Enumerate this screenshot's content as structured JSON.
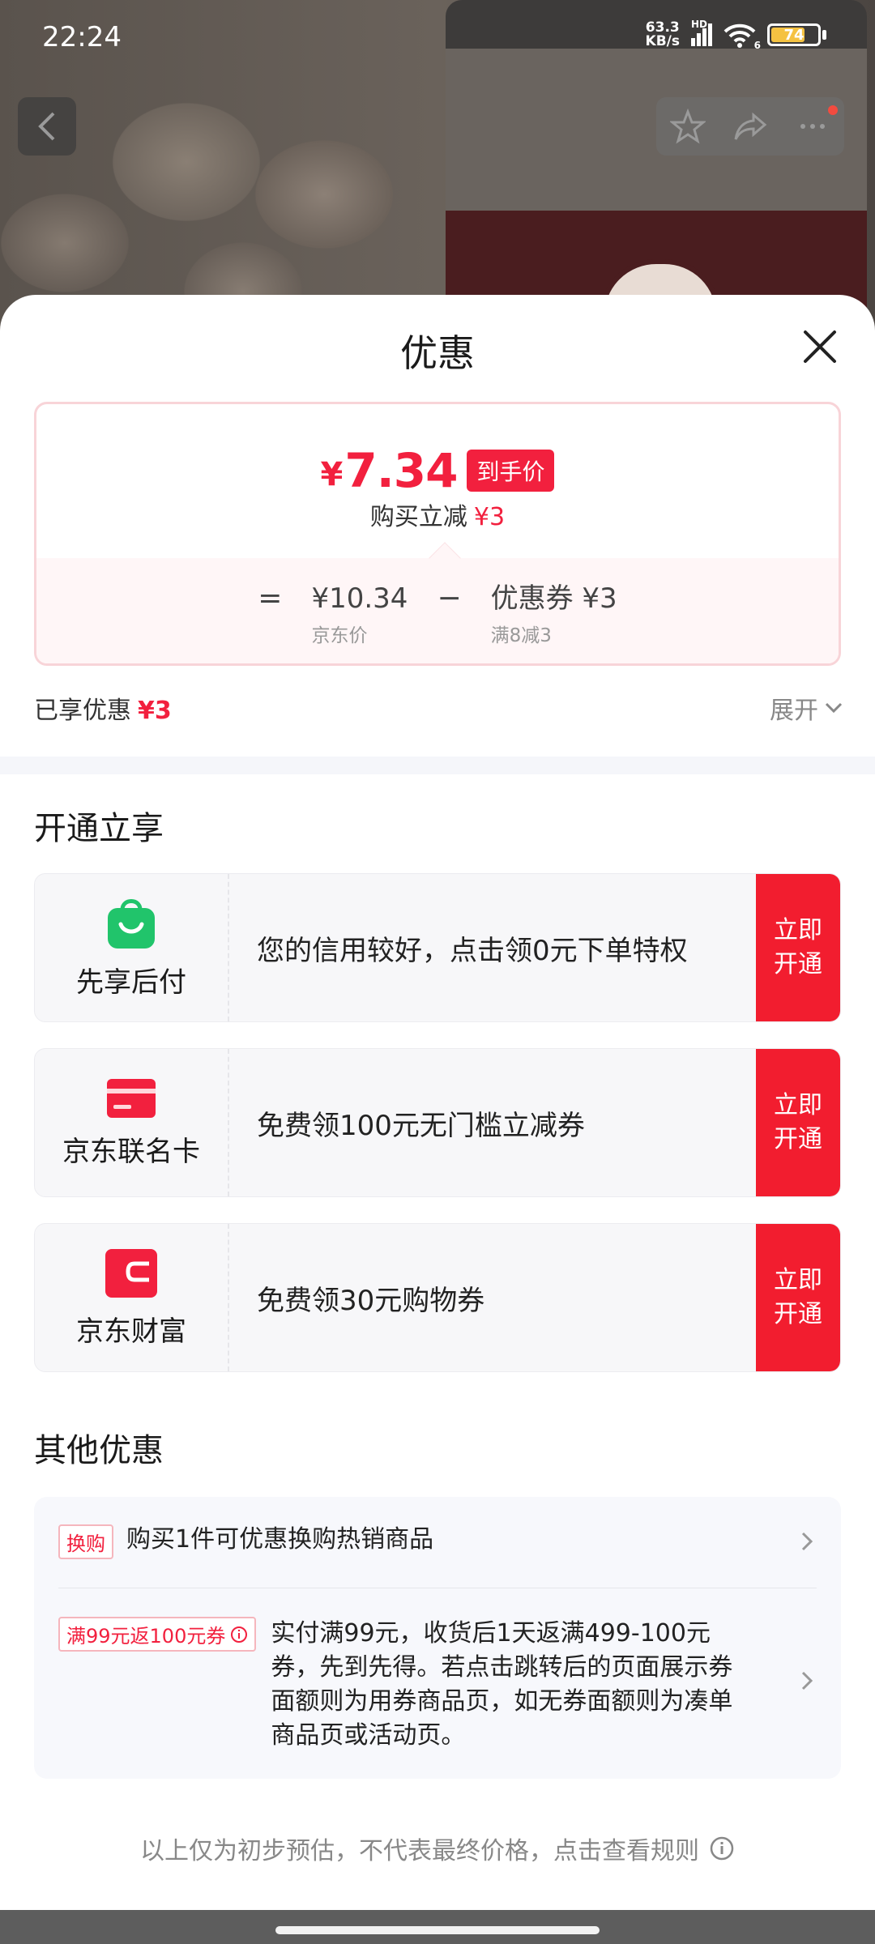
{
  "status_bar": {
    "time": "22:24",
    "net_speed_value": "63.3",
    "net_speed_unit": "KB/s",
    "network_label": "HD",
    "wifi_label": "6",
    "battery": "74",
    "battery_level": 0.74
  },
  "sheet": {
    "title": "优惠"
  },
  "price": {
    "currency": "¥",
    "final": "7.34",
    "final_badge": "到手价",
    "instant_label": "购买立减",
    "instant_value": "¥3",
    "equals": "=",
    "jd_price": "¥10.34",
    "jd_price_label": "京东价",
    "minus": "−",
    "coupon": "优惠券 ¥3",
    "coupon_condition": "满8减3"
  },
  "summary": {
    "enjoyed_label": "已享优惠",
    "enjoyed_value": "¥3",
    "expand_label": "展开"
  },
  "section_open": {
    "title": "开通立享",
    "offers": [
      {
        "name": "先享后付",
        "desc": "您的信用较好，点击领0元下单特权",
        "button_line1": "立即",
        "button_line2": "开通",
        "icon": "shopping-bag-icon",
        "color": "#21c46b"
      },
      {
        "name": "京东联名卡",
        "desc": "免费领100元无门槛立减券",
        "button_line1": "立即",
        "button_line2": "开通",
        "icon": "credit-card-icon",
        "color": "#f2203e"
      },
      {
        "name": "京东财富",
        "desc": "免费领30元购物券",
        "button_line1": "立即",
        "button_line2": "开通",
        "icon": "wallet-icon",
        "color": "#f2203e"
      }
    ]
  },
  "section_other": {
    "title": "其他优惠",
    "items": [
      {
        "tag": "换购",
        "text": "购买1件可优惠换购热销商品"
      },
      {
        "tag": "满99元返100元券",
        "text_lines": [
          "实付满99元，收货后1天返满499-100元",
          "券，先到先得。若点击跳转后的页面展示券",
          "面额则为用券商品页，如无券面额则为凑单",
          "商品页或活动页。"
        ]
      }
    ]
  },
  "footnote": "以上仅为初步预估，不代表最终价格，点击查看规则",
  "colors": {
    "accent": "#f2203e",
    "green": "#21c46b"
  }
}
